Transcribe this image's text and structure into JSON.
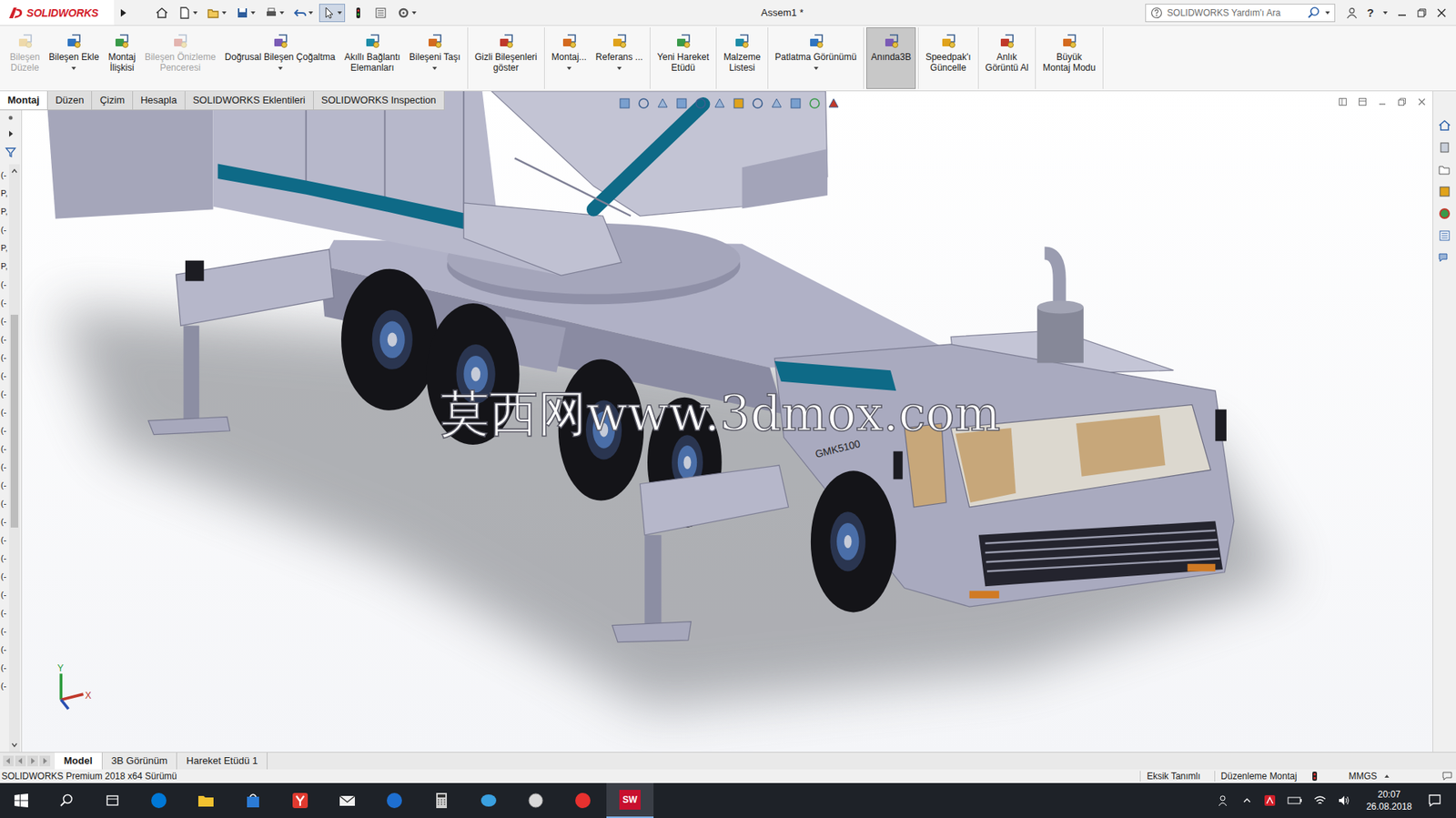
{
  "window": {
    "title": "Assem1 *",
    "app": "SOLIDWORKS",
    "help": "?"
  },
  "search": {
    "placeholder": "SOLIDWORKS Yardım'ı Ara"
  },
  "quick_access": [
    {
      "pressed": false
    },
    {
      "pressed": false
    },
    {
      "pressed": false
    },
    {
      "pressed": false
    },
    {
      "pressed": false
    },
    {
      "pressed": false
    },
    {
      "pressed": true
    },
    {
      "pressed": false
    },
    {
      "pressed": false
    },
    {
      "pressed": false
    }
  ],
  "ribbon": {
    "groups": [
      [
        {
          "label": [
            "Bileşen",
            "Düzele"
          ],
          "disabled": true,
          "dropdown": false,
          "selected": false
        },
        {
          "label": [
            "Bileşen Ekle"
          ],
          "disabled": false,
          "dropdown": true,
          "selected": false
        },
        {
          "label": [
            "Montaj",
            "İlişkisi"
          ],
          "disabled": false,
          "dropdown": false,
          "selected": false
        },
        {
          "label": [
            "Bileşen Önizleme",
            "Penceresi"
          ],
          "disabled": true,
          "dropdown": false,
          "selected": false
        },
        {
          "label": [
            "Doğrusal Bileşen Çoğaltma"
          ],
          "disabled": false,
          "dropdown": true,
          "selected": false
        },
        {
          "label": [
            "Akıllı Bağlantı",
            "Elemanları"
          ],
          "disabled": false,
          "dropdown": false,
          "selected": false
        },
        {
          "label": [
            "Bileşeni Taşı"
          ],
          "disabled": false,
          "dropdown": true,
          "selected": false
        }
      ],
      [
        {
          "label": [
            "Gizli Bileşenleri",
            "göster"
          ],
          "disabled": false,
          "dropdown": false,
          "selected": false
        }
      ],
      [
        {
          "label": [
            "Montaj..."
          ],
          "disabled": false,
          "dropdown": true,
          "selected": false
        },
        {
          "label": [
            "Referans ..."
          ],
          "disabled": false,
          "dropdown": true,
          "selected": false
        }
      ],
      [
        {
          "label": [
            "Yeni Hareket",
            "Etüdü"
          ],
          "disabled": false,
          "dropdown": false,
          "selected": false
        }
      ],
      [
        {
          "label": [
            "Malzeme",
            "Listesi"
          ],
          "disabled": false,
          "dropdown": false,
          "selected": false
        }
      ],
      [
        {
          "label": [
            "Patlatma Görünümü"
          ],
          "disabled": false,
          "dropdown": true,
          "selected": false
        }
      ],
      [
        {
          "label": [
            "Anında3B"
          ],
          "disabled": false,
          "dropdown": false,
          "selected": true
        }
      ],
      [
        {
          "label": [
            "Speedpak'ı",
            "Güncelle"
          ],
          "disabled": false,
          "dropdown": false,
          "selected": false
        }
      ],
      [
        {
          "label": [
            "Anlık",
            "Görüntü Al"
          ],
          "disabled": false,
          "dropdown": false,
          "selected": false
        }
      ],
      [
        {
          "label": [
            "Büyük",
            "Montaj Modu"
          ],
          "disabled": false,
          "dropdown": false,
          "selected": false
        }
      ]
    ]
  },
  "tabs": [
    {
      "label": "Montaj",
      "selected": true
    },
    {
      "label": "Düzen",
      "selected": false
    },
    {
      "label": "Çizim",
      "selected": false
    },
    {
      "label": "Hesapla",
      "selected": false
    },
    {
      "label": "SOLIDWORKS Eklentileri",
      "selected": false
    },
    {
      "label": "SOLIDWORKS Inspection",
      "selected": false
    }
  ],
  "feature_tree": {
    "items": [
      "(-",
      "P,",
      "P,",
      "(-",
      "P,",
      "P,",
      "(-",
      "(-",
      "(-",
      "(-",
      "(-",
      "(-",
      "(-",
      "(-",
      "(-",
      "(-",
      "(-",
      "(-",
      "(-",
      "(-",
      "(-",
      "(-",
      "(-",
      "(-",
      "(-",
      "(-",
      "(-",
      "(-",
      "(-"
    ]
  },
  "viewport": {
    "watermark": "莫西网www.3dmox.com",
    "cab_label": "GMK5100",
    "axes": {
      "x": "X",
      "y": "Y"
    }
  },
  "bottom_tabs": [
    {
      "label": "Model",
      "selected": true
    },
    {
      "label": "3B Görünüm",
      "selected": false
    },
    {
      "label": "Hareket Etüdü 1",
      "selected": false
    }
  ],
  "status_bar": {
    "left": "SOLIDWORKS Premium 2018 x64 Sürümü",
    "items": [
      "Eksik Tanımlı",
      "Düzenleme Montaj"
    ],
    "units": "MMGS"
  },
  "taskbar": {
    "apps": [
      {
        "active": false
      },
      {
        "active": false
      },
      {
        "active": false
      },
      {
        "active": false
      },
      {
        "active": false
      },
      {
        "active": false
      },
      {
        "active": false
      },
      {
        "active": false
      },
      {
        "active": false
      },
      {
        "active": false
      },
      {
        "active": true
      }
    ],
    "sw_label": "SW",
    "time": "20:07",
    "date": "26.08.2018"
  }
}
